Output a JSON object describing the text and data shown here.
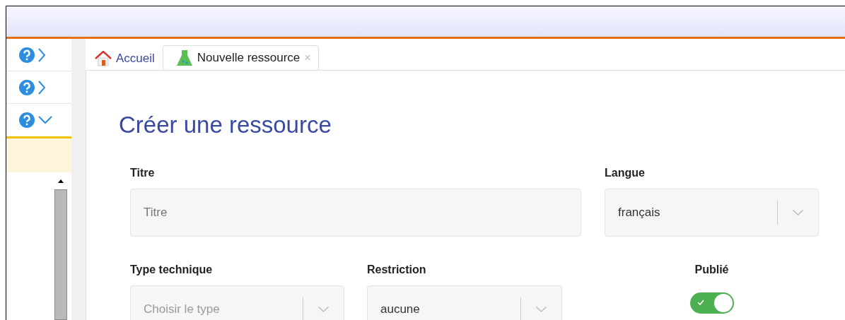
{
  "sidebar": {
    "items": [
      {
        "expanded": false
      },
      {
        "expanded": false
      },
      {
        "expanded": true
      }
    ]
  },
  "tabs": [
    {
      "label": "Accueil",
      "selected": false,
      "closable": false,
      "kind": "home"
    },
    {
      "label": "Nouvelle ressource",
      "selected": true,
      "closable": true,
      "kind": "flask"
    }
  ],
  "close_glyph": "×",
  "heading": "Créer une ressource",
  "fields": [
    {
      "kind": "text",
      "label": "Titre",
      "placeholder": "Titre"
    },
    {
      "kind": "select",
      "label": "Langue",
      "value": "français"
    },
    {
      "kind": "select",
      "label": "Type technique",
      "placeholder": "Choisir le type"
    },
    {
      "kind": "select",
      "label": "Restriction",
      "value": "aucune"
    },
    {
      "kind": "toggle",
      "label": "Publié",
      "on": true
    }
  ]
}
